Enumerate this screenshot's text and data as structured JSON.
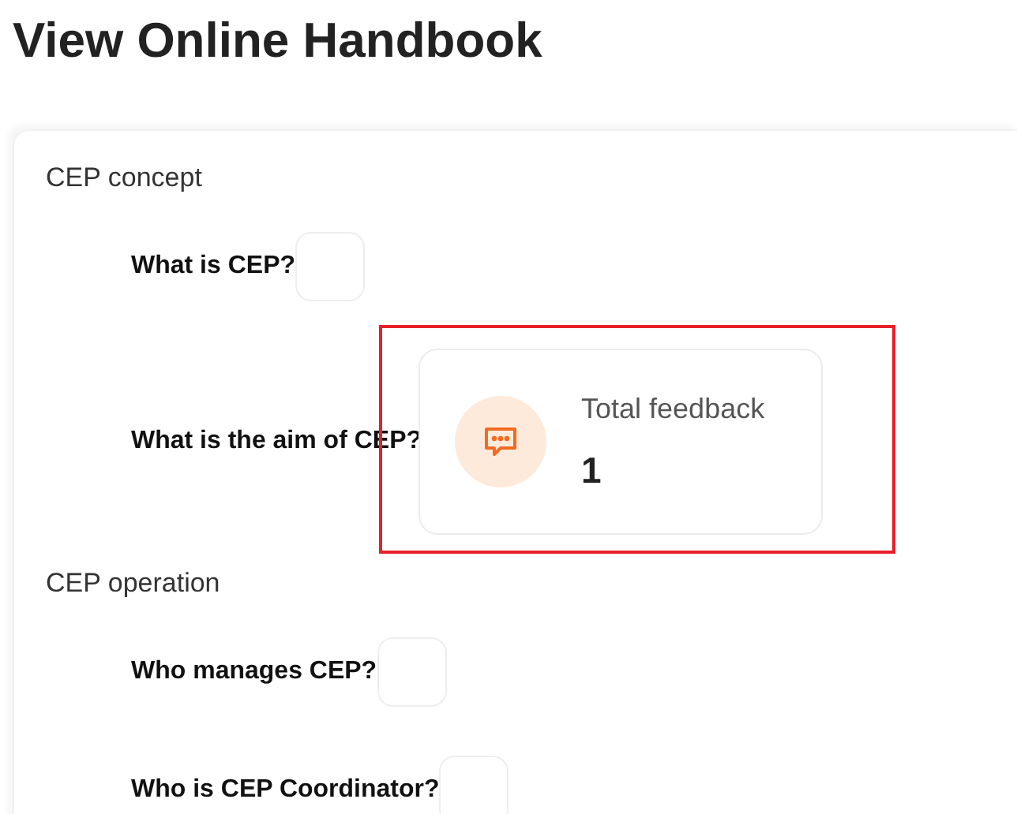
{
  "title": "View Online Handbook",
  "sections": [
    {
      "label": "CEP concept",
      "items": [
        {
          "question": "What is CEP?"
        },
        {
          "question": "What is the aim of CEP?",
          "stat": {
            "label": "Total feedback",
            "value": "1",
            "highlighted": true
          }
        }
      ]
    },
    {
      "label": "CEP operation",
      "items": [
        {
          "question": "Who manages CEP?"
        },
        {
          "question": "Who is CEP Coordinator?"
        }
      ]
    }
  ]
}
